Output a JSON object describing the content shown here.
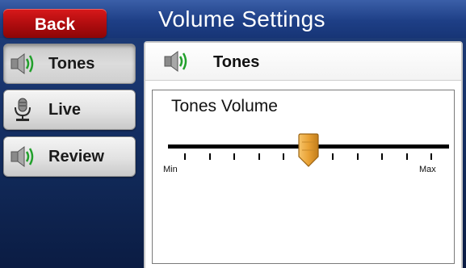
{
  "header": {
    "title": "Volume Settings",
    "back_label": "Back"
  },
  "sidebar": {
    "items": [
      {
        "label": "Tones",
        "icon": "speaker-icon",
        "selected": true
      },
      {
        "label": "Live",
        "icon": "microphone-icon",
        "selected": false
      },
      {
        "label": "Review",
        "icon": "speaker-icon",
        "selected": false
      }
    ]
  },
  "panel": {
    "heading": "Tones",
    "heading_icon": "speaker-icon",
    "volume_label": "Tones Volume",
    "slider": {
      "min_label": "Min",
      "max_label": "Max",
      "level_fraction": 0.5,
      "tick_count": 11
    }
  },
  "colors": {
    "accent_red": "#c8191b",
    "speaker_green": "#22a02c",
    "thumb_orange": "#e9a235"
  }
}
